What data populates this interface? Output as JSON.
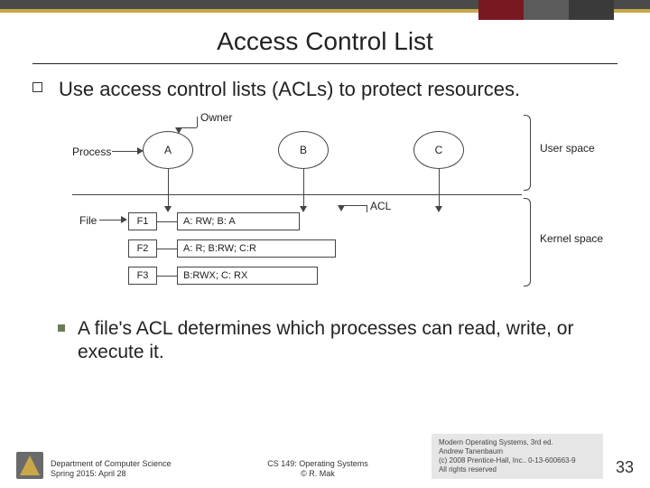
{
  "slide": {
    "title": "Access Control List",
    "bullet1": "Use access control lists (ACLs) to protect resources.",
    "bullet2": "A file's ACL determines which processes can read, write, or execute it."
  },
  "diagram": {
    "process_label": "Process",
    "owner_label": "Owner",
    "file_label": "File",
    "acl_label": "ACL",
    "userspace_label": "User space",
    "kernelspace_label": "Kernel space",
    "circles": {
      "A": "A",
      "B": "B",
      "C": "C"
    },
    "rows": [
      {
        "file": "F1",
        "acl": "A: RW;  B: A"
      },
      {
        "file": "F2",
        "acl": "A: R;  B:RW;  C:R"
      },
      {
        "file": "F3",
        "acl": "B:RWX;  C: RX"
      }
    ]
  },
  "footer": {
    "dept_line1": "Department of Computer Science",
    "dept_line2": "Spring 2015: April 28",
    "course_line1": "CS 149: Operating Systems",
    "course_line2": "© R. Mak",
    "credit_line1": "Modern Operating Systems, 3rd ed.",
    "credit_line2": "Andrew Tanenbaum",
    "credit_line3": "(c) 2008 Prentice-Hall, Inc.. 0-13-600663-9",
    "credit_line4": "All rights reserved",
    "page": "33"
  }
}
